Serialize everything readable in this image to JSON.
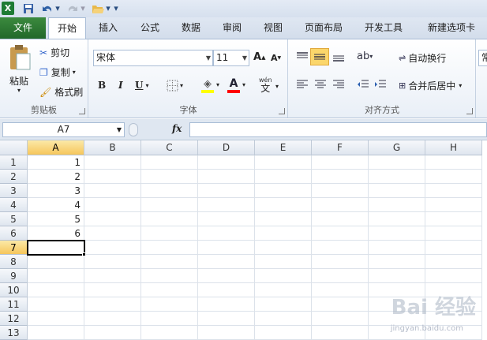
{
  "quick_access": {
    "excel_icon": "excel-logo-icon",
    "save_icon": "save-icon",
    "undo_icon": "undo-icon",
    "redo_icon": "redo-icon",
    "open_icon": "open-folder-icon",
    "customize_icon": "customize-qat-icon"
  },
  "tabs": [
    {
      "label": "文件"
    },
    {
      "label": "开始"
    },
    {
      "label": "插入"
    },
    {
      "label": "公式"
    },
    {
      "label": "数据"
    },
    {
      "label": "审阅"
    },
    {
      "label": "视图"
    },
    {
      "label": "页面布局"
    },
    {
      "label": "开发工具"
    },
    {
      "label": "新建选项卡"
    }
  ],
  "clipboard": {
    "group_label": "剪贴板",
    "paste": "粘贴",
    "cut": "剪切",
    "copy": "复制",
    "format_painter": "格式刷"
  },
  "font": {
    "group_label": "字体",
    "font_name": "宋体",
    "font_size": "11",
    "bold": "B",
    "italic": "I",
    "underline": "U",
    "grow": "A",
    "shrink": "A",
    "wen": "wén",
    "wen_char": "文"
  },
  "alignment": {
    "group_label": "对齐方式",
    "wrap_text": "自动换行",
    "merge_center": "合并后居中"
  },
  "number": {
    "partial": "常"
  },
  "formula_bar": {
    "name_box": "A7",
    "fx": "fx",
    "formula": ""
  },
  "sheet": {
    "columns": [
      "A",
      "B",
      "C",
      "D",
      "E",
      "F",
      "G",
      "H"
    ],
    "rows": [
      "1",
      "2",
      "3",
      "4",
      "5",
      "6",
      "7",
      "8",
      "9",
      "10",
      "11",
      "12",
      "13"
    ],
    "col_a_values": [
      "1",
      "2",
      "3",
      "4",
      "5",
      "6",
      "",
      "",
      "",
      "",
      "",
      "",
      ""
    ],
    "selected_cell": "A7"
  },
  "watermark": {
    "text": "Bai 经验",
    "url": "jingyan.baidu.com"
  },
  "colors": {
    "file_tab": "#2e7d32",
    "selection_header": "#f6c65b",
    "highlight": "#ffff00",
    "font_color": "#ff0000"
  }
}
